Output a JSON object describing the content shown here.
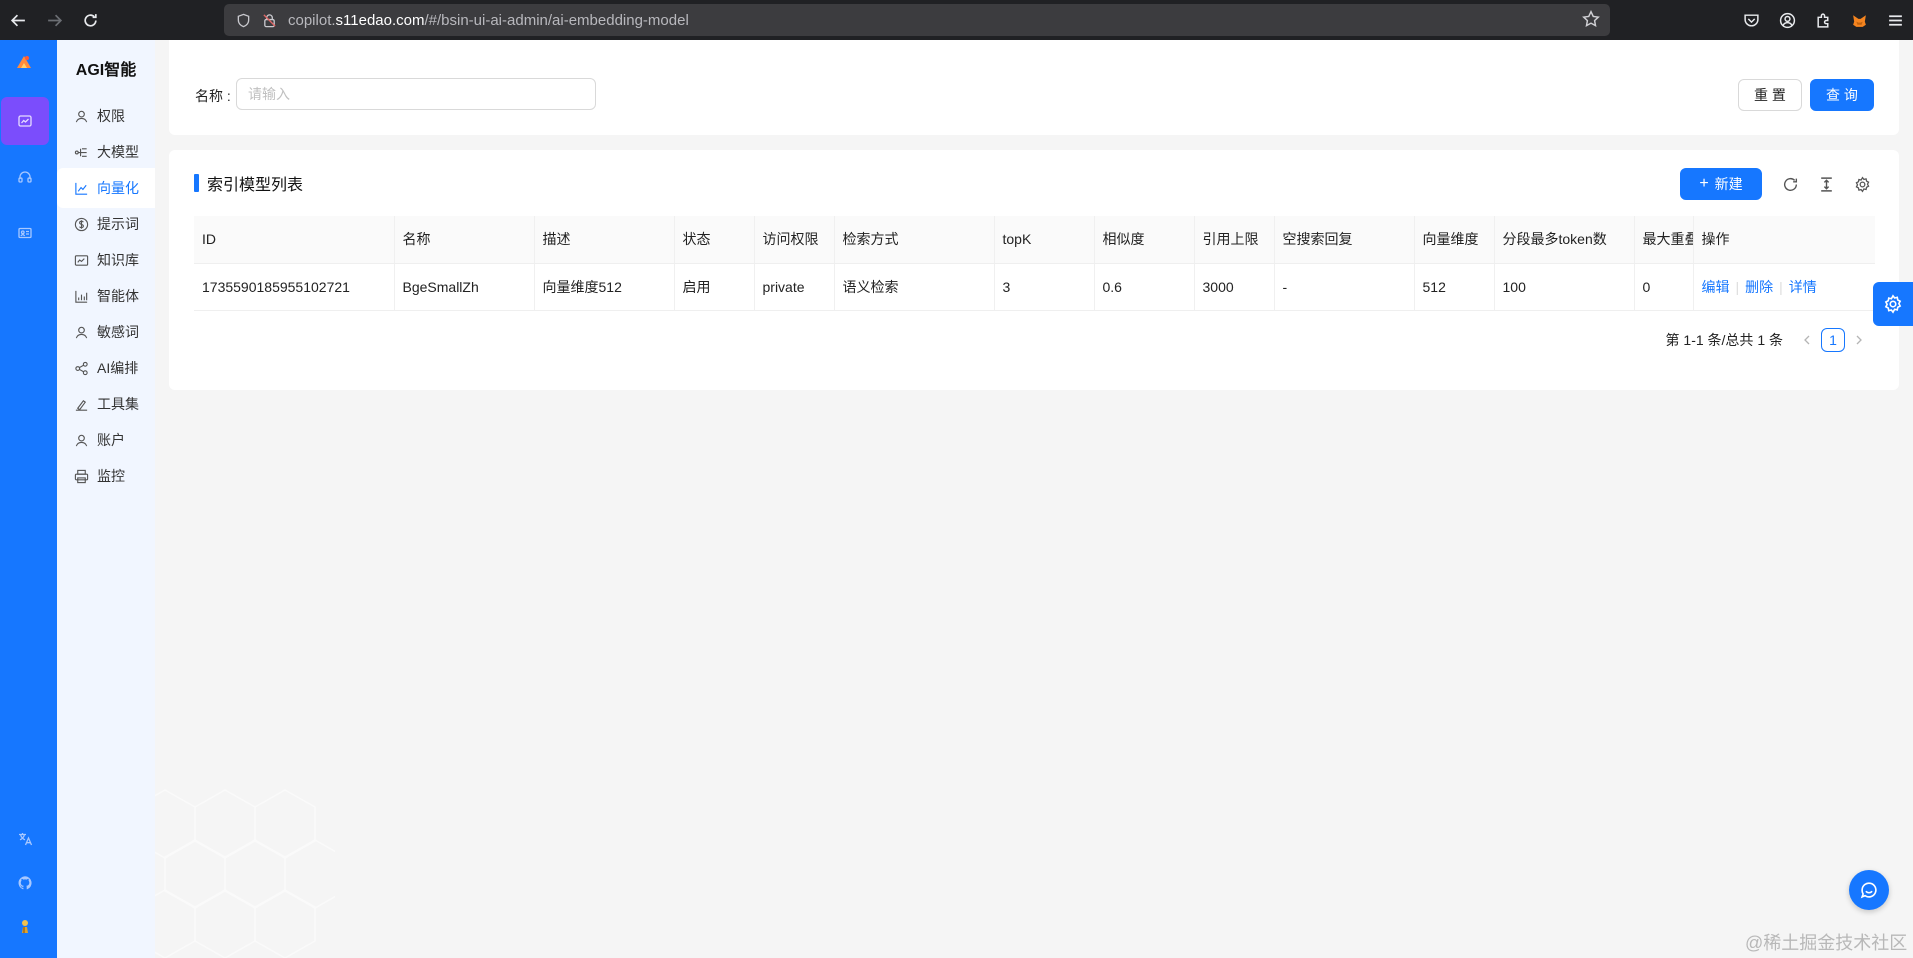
{
  "browser": {
    "url_prefix": "copilot.",
    "url_domain": "s11edao.com",
    "url_path": "/#/bsin-ui-ai-admin/ai-embedding-model"
  },
  "menu": {
    "title": "AGI智能",
    "items": [
      {
        "label": "权限",
        "icon": "user-icon"
      },
      {
        "label": "大模型",
        "icon": "flow-icon"
      },
      {
        "label": "向量化",
        "icon": "chart-icon",
        "active": true
      },
      {
        "label": "提示词",
        "icon": "dollar-icon"
      },
      {
        "label": "知识库",
        "icon": "book-icon"
      },
      {
        "label": "智能体",
        "icon": "bar-chart-icon"
      },
      {
        "label": "敏感词",
        "icon": "user-icon"
      },
      {
        "label": "AI编排",
        "icon": "share-icon"
      },
      {
        "label": "工具集",
        "icon": "tool-icon"
      },
      {
        "label": "账户",
        "icon": "user-icon"
      },
      {
        "label": "监控",
        "icon": "printer-icon"
      }
    ]
  },
  "search": {
    "label": "名称 :",
    "placeholder": "请输入",
    "value": "",
    "reset_label": "重 置",
    "query_label": "查 询"
  },
  "list": {
    "title": "索引模型列表",
    "new_label": "新建",
    "columns": [
      "ID",
      "名称",
      "描述",
      "状态",
      "访问权限",
      "检索方式",
      "topK",
      "相似度",
      "引用上限",
      "空搜索回复",
      "向量维度",
      "分段最多token数",
      "最大重叠token数",
      "操作"
    ],
    "rows": [
      {
        "cells": [
          "1735590185955102721",
          "BgeSmallZh",
          "向量维度512",
          "启用",
          "private",
          "语义检索",
          "3",
          "0.6",
          "3000",
          "-",
          "512",
          "100",
          "0"
        ],
        "actions": [
          "编辑",
          "删除",
          "详情"
        ]
      }
    ],
    "pagination": {
      "summary": "第 1-1 条/总共 1 条",
      "current_page": "1"
    }
  },
  "watermark": "@稀土掘金技术社区",
  "colors": {
    "primary": "#1677ff",
    "rail_active": "#7b4dfc",
    "menu_bg": "#f1f6ff"
  }
}
